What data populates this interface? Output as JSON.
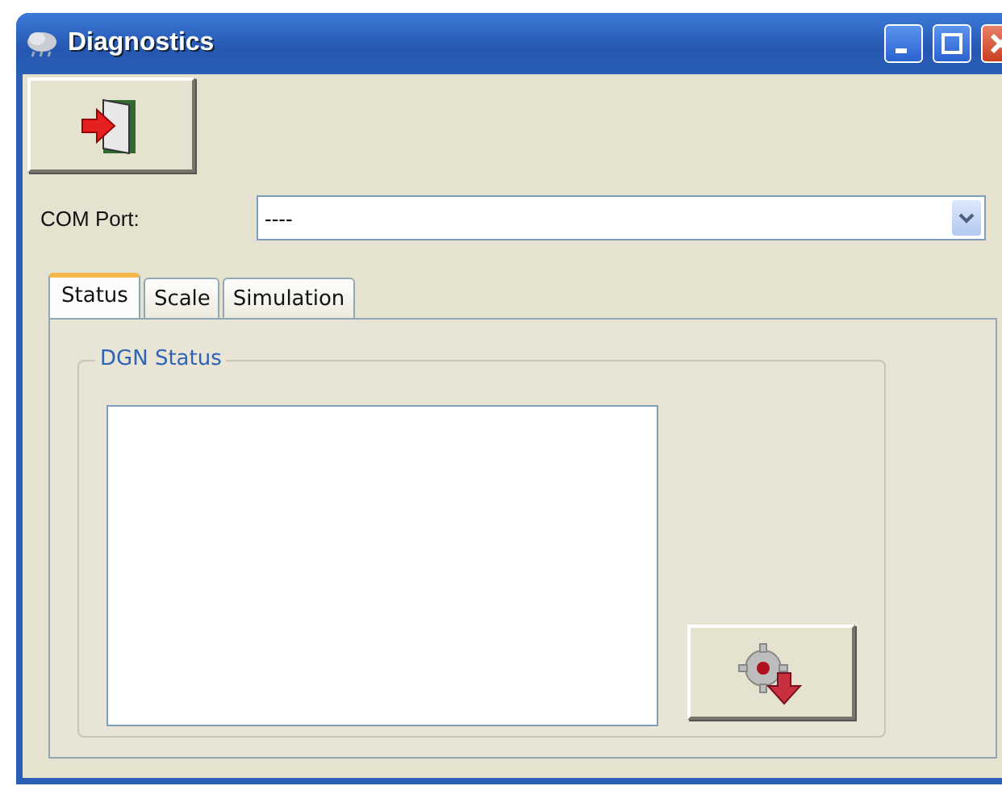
{
  "window": {
    "title": "Diagnostics"
  },
  "com_port": {
    "label": "COM Port:",
    "value": "----"
  },
  "tabs": [
    {
      "label": "Status",
      "selected": true
    },
    {
      "label": "Scale",
      "selected": false
    },
    {
      "label": "Simulation",
      "selected": false
    }
  ],
  "status_group": {
    "title": "DGN Status"
  }
}
